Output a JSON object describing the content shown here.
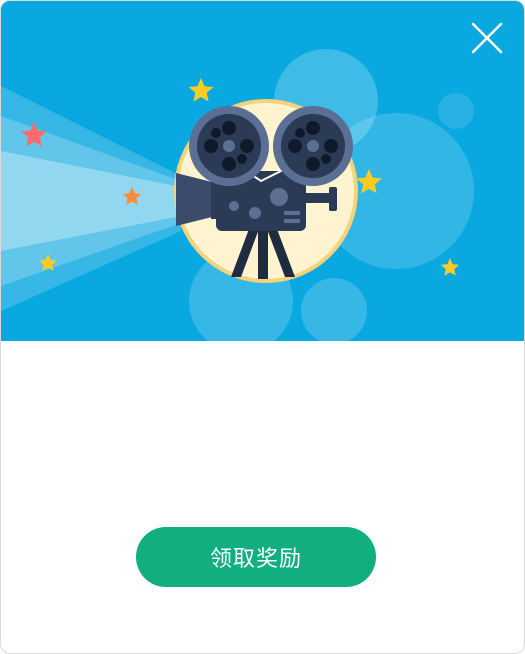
{
  "dialog": {
    "claim_button_label": "领取奖励",
    "close_icon": "close-icon",
    "illustration": "movie-camera-illustration"
  },
  "colors": {
    "banner_bg": "#0aa8e0",
    "button_bg": "#11ae7f",
    "button_text": "#ffffff",
    "camera_body": "#2b3a55",
    "star_yellow": "#ffcc1f",
    "star_orange": "#ff8a3c",
    "star_red": "#ff6b6b"
  }
}
